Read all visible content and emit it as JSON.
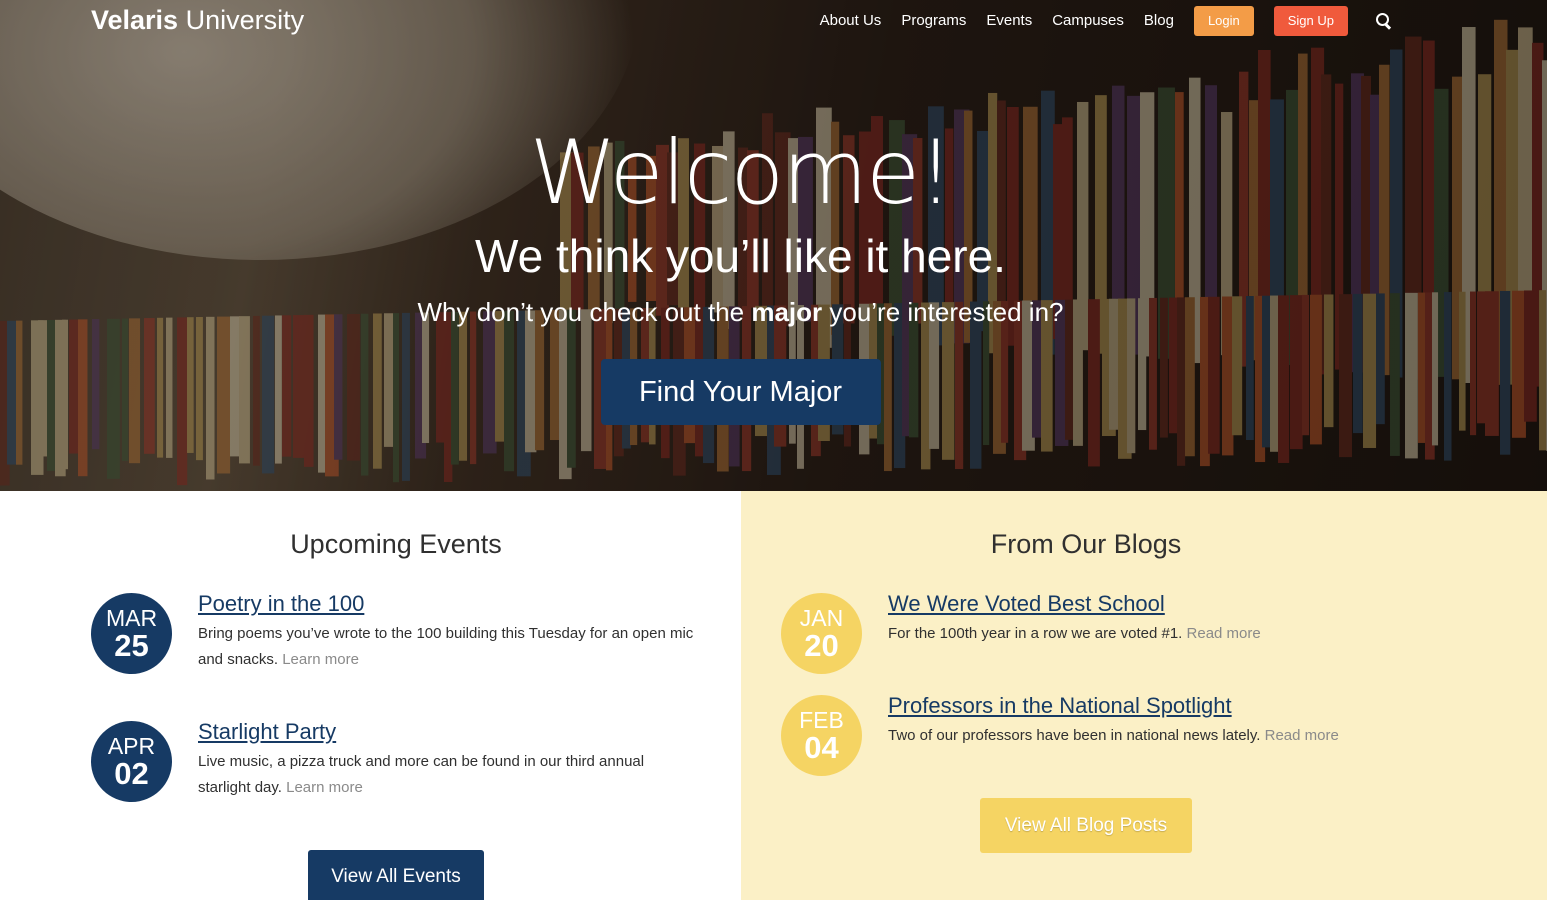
{
  "nav": {
    "logo_bold": "Velaris",
    "logo_light": "University",
    "links": [
      "About Us",
      "Programs",
      "Events",
      "Campuses",
      "Blog"
    ],
    "login_label": "Login",
    "signup_label": "Sign Up",
    "search_icon": "search-icon"
  },
  "hero": {
    "title": "Welcome!",
    "subtitle": "We think you’ll like it here.",
    "question_pre": "Why don’t you check out the ",
    "question_bold": "major",
    "question_post": " you’re interested in?",
    "cta_label": "Find Your Major"
  },
  "events": {
    "title": "Upcoming Events",
    "items": [
      {
        "month": "MAR",
        "day": "25",
        "title": "Poetry in the 100",
        "text": "Bring poems you’ve wrote to the 100 building this Tuesday for an open mic and snacks.",
        "more": "Learn more"
      },
      {
        "month": "APR",
        "day": "02",
        "title": "Starlight Party",
        "text": "Live music, a pizza truck and more can be found in our third annual starlight day.",
        "more": "Learn more"
      }
    ],
    "button_label": "View All Events"
  },
  "blogs": {
    "title": "From Our Blogs",
    "items": [
      {
        "month": "JAN",
        "day": "20",
        "title": "We Were Voted Best School",
        "text": "For the 100th year in a row we are voted #1.",
        "more": "Read more"
      },
      {
        "month": "FEB",
        "day": "04",
        "title": "Professors in the National Spotlight",
        "text": "Two of our professors have been in national news lately.",
        "more": "Read more"
      }
    ],
    "button_label": "View All Blog Posts"
  },
  "colors": {
    "primary_blue": "#163a64",
    "accent_yellow": "#f5d463",
    "login_orange": "#f39c47",
    "signup_red": "#f05a3c",
    "blog_background": "#fbf0c6"
  }
}
